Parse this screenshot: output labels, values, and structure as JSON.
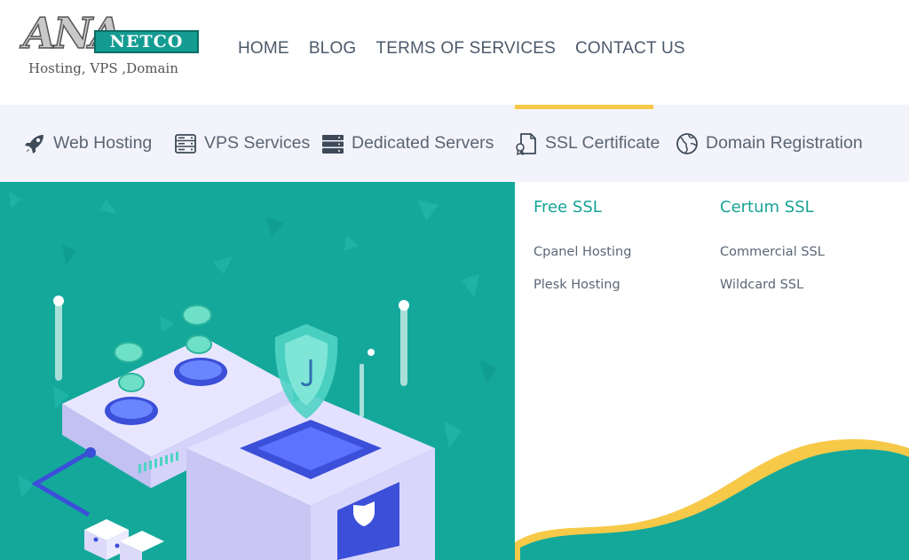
{
  "logo": {
    "mark": "ANA",
    "brand": "NETCO",
    "tagline": "Hosting, VPS ,Domain"
  },
  "top_nav": [
    {
      "label": "HOME"
    },
    {
      "label": "BLOG"
    },
    {
      "label": "TERMS OF SERVICES"
    },
    {
      "label": "CONTACT US"
    }
  ],
  "category_nav": [
    {
      "label": "Web Hosting",
      "icon": "rocket-icon"
    },
    {
      "label": "VPS Services",
      "icon": "server-icon"
    },
    {
      "label": "Dedicated Servers",
      "icon": "server-stack-icon"
    },
    {
      "label": "SSL Certificate",
      "icon": "certificate-icon",
      "active": true
    },
    {
      "label": "Domain Registration",
      "icon": "globe-icon"
    }
  ],
  "dropdown": {
    "columns": [
      {
        "heading": "Free SSL",
        "items": [
          "Cpanel Hosting",
          "Plesk Hosting"
        ]
      },
      {
        "heading": "Certum SSL",
        "items": [
          "Commercial SSL",
          "Wildcard SSL"
        ]
      }
    ]
  },
  "colors": {
    "teal": "#14a89b",
    "accent": "#f7c948",
    "nav_text": "#4c5a6b",
    "heading_teal": "#16a396"
  }
}
